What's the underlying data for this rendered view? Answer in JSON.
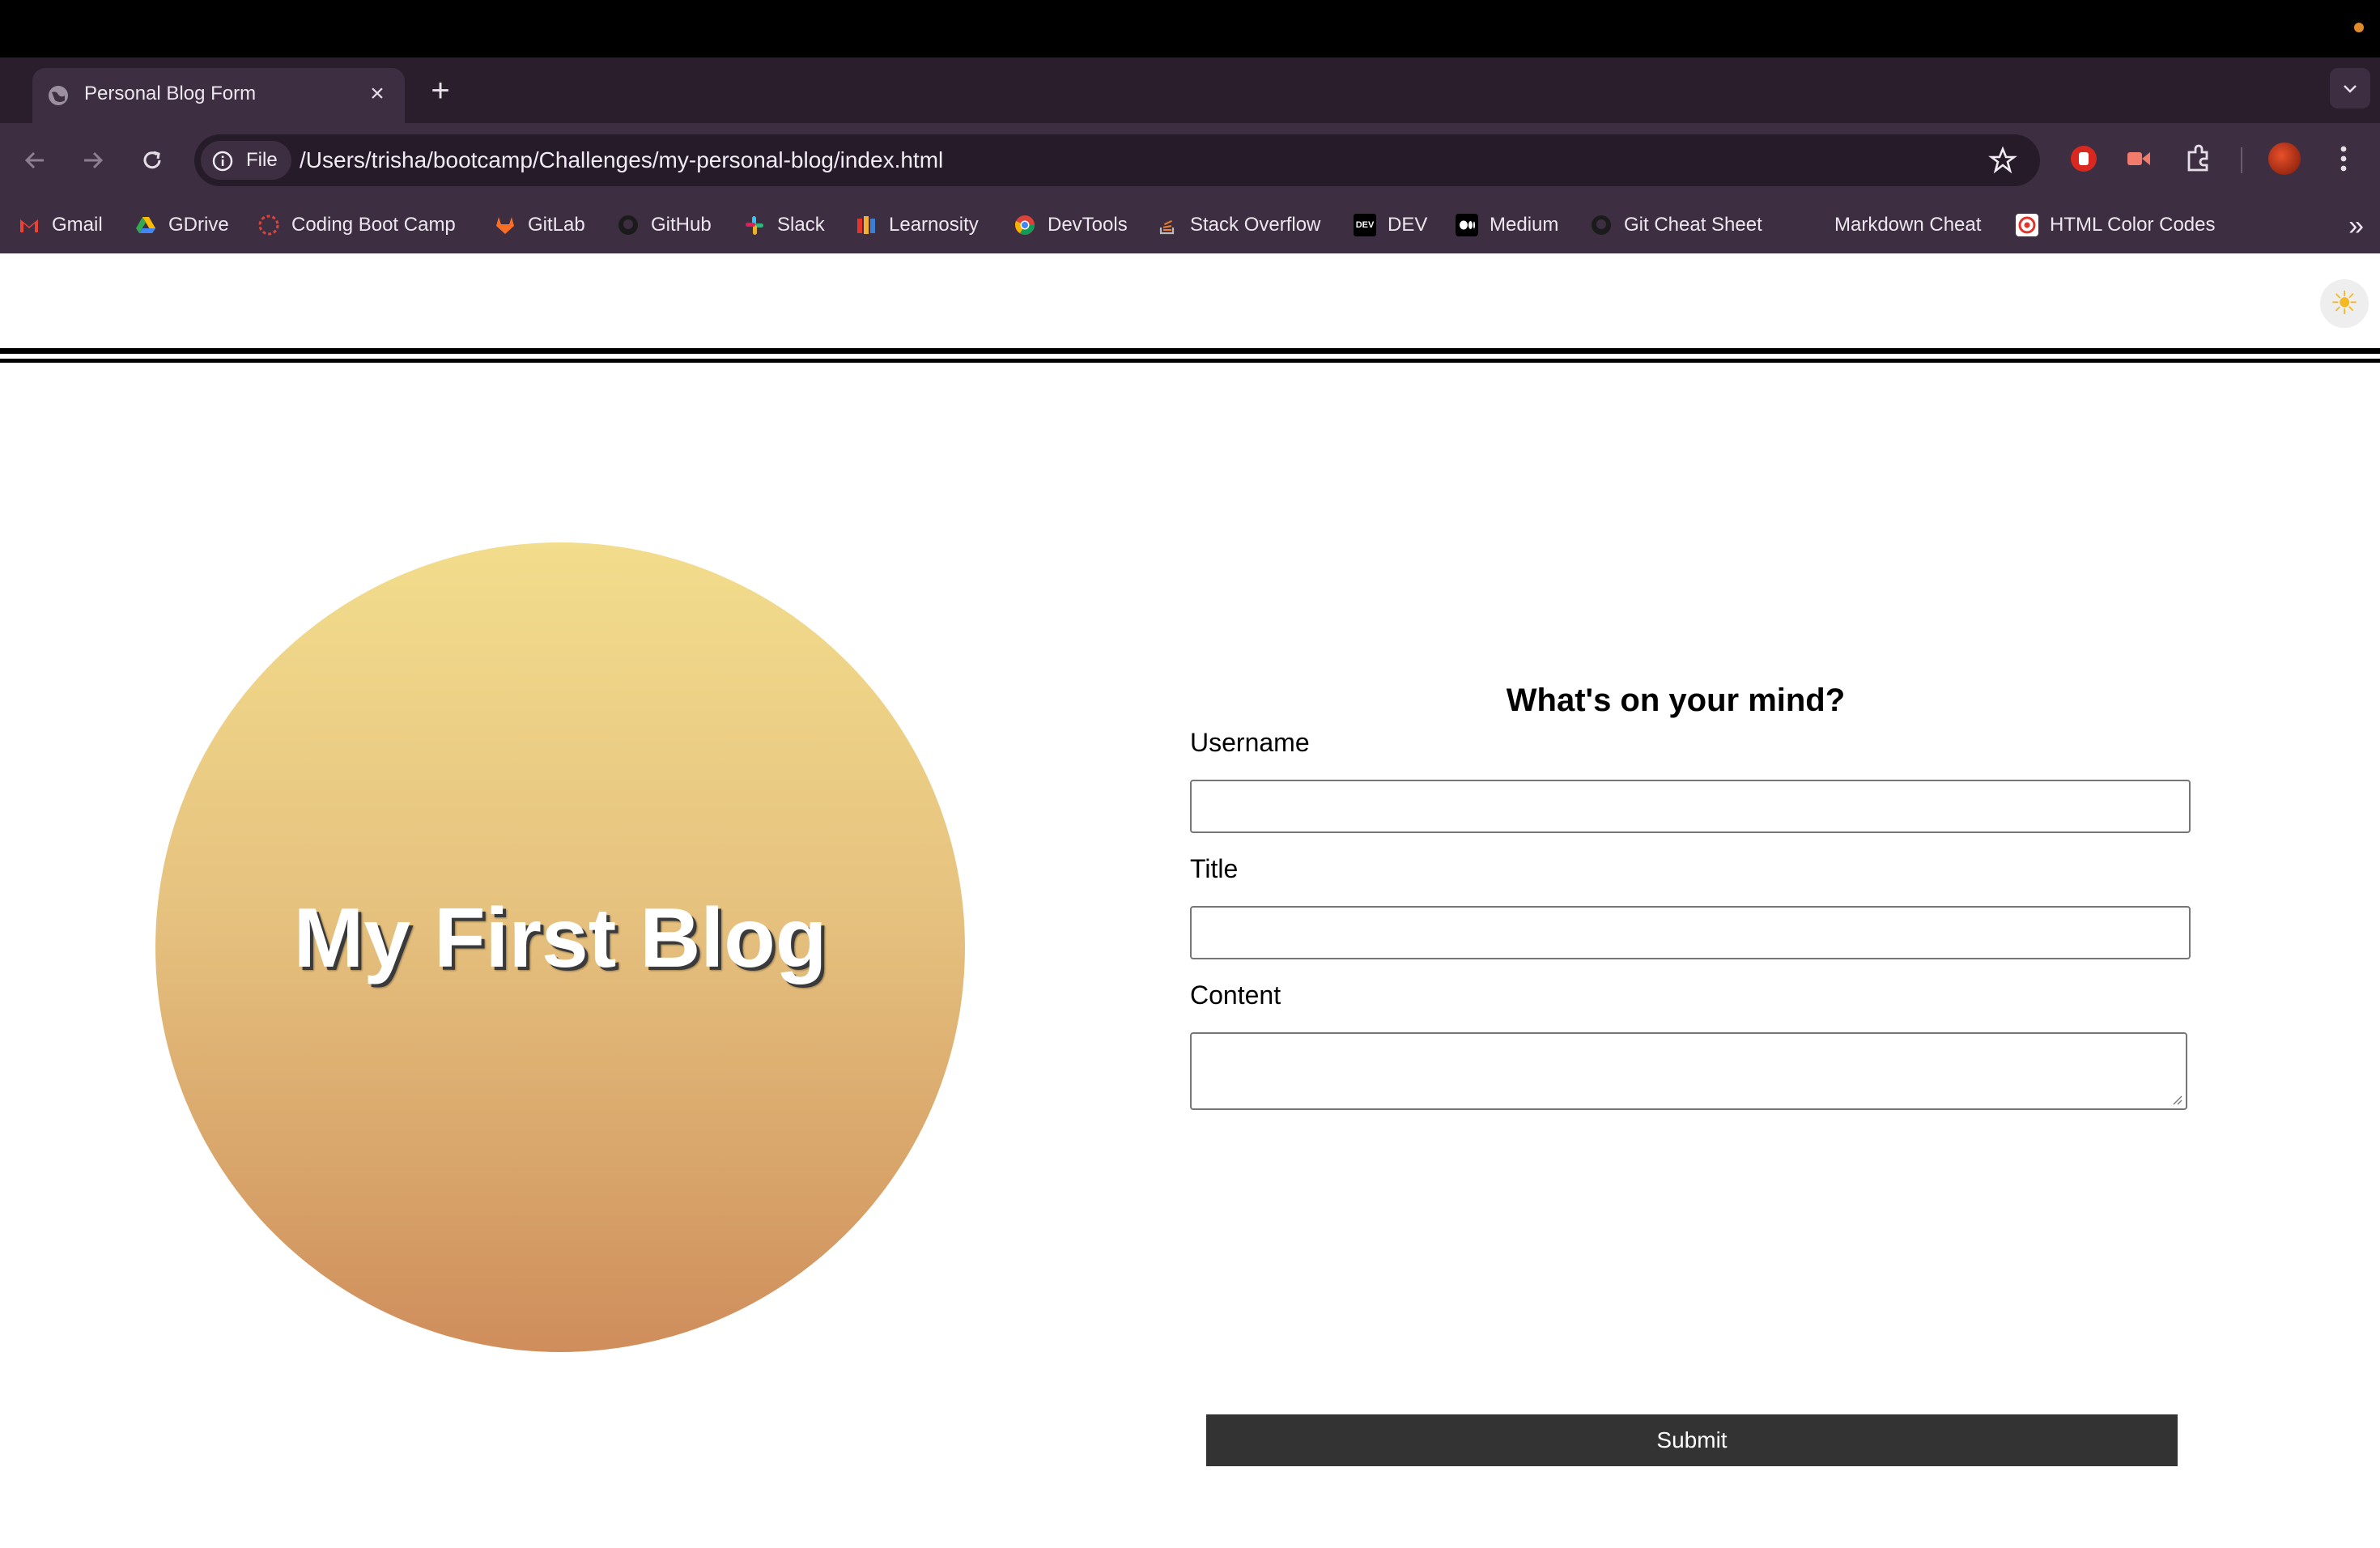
{
  "browser": {
    "tab": {
      "title": "Personal Blog Form"
    },
    "address": {
      "chip_label": "File",
      "url": "/Users/trisha/bootcamp/Challenges/my-personal-blog/index.html"
    },
    "bookmarks": [
      {
        "label": "Gmail",
        "icon": "gmail-icon",
        "color": "#ea4335"
      },
      {
        "label": "GDrive",
        "icon": "gdrive-icon",
        "color": "#34a853"
      },
      {
        "label": "Coding Boot Camp",
        "icon": "bootcamp-icon",
        "color": "#d9453a"
      },
      {
        "label": "GitLab",
        "icon": "gitlab-icon",
        "color": "#fc6d26"
      },
      {
        "label": "GitHub",
        "icon": "github-icon",
        "color": "#1b1b1b"
      },
      {
        "label": "Slack",
        "icon": "slack-icon",
        "color": "#36c5f0"
      },
      {
        "label": "Learnosity",
        "icon": "learnosity-icon",
        "color": "#f2b134"
      },
      {
        "label": "DevTools",
        "icon": "chrome-icon",
        "color": "#4285f4"
      },
      {
        "label": "Stack Overflow",
        "icon": "stackoverflow-icon",
        "color": "#f48024"
      },
      {
        "label": "DEV",
        "icon": "dev-icon",
        "color": "#000000"
      },
      {
        "label": "Medium",
        "icon": "medium-icon",
        "color": "#000000"
      },
      {
        "label": "Git Cheat Sheet",
        "icon": "github-icon",
        "color": "#1b1b1b"
      },
      {
        "label": "Markdown Cheat",
        "icon": "markdown-icon",
        "color": "#3d2f41"
      },
      {
        "label": "HTML Color Codes",
        "icon": "htmlcolor-icon",
        "color": "#e0352b"
      }
    ]
  },
  "page": {
    "hero_title": "My First Blog",
    "form": {
      "heading": "What's on your mind?",
      "username_label": "Username",
      "username_value": "",
      "title_label": "Title",
      "title_value": "",
      "content_label": "Content",
      "content_value": "",
      "submit_label": "Submit"
    },
    "theme_toggle_icon": "sun-icon"
  },
  "colors": {
    "chrome_dark": "#2a1e2d",
    "chrome_toolbar": "#3d2f41",
    "submit_bg": "#333333",
    "hero_top": "#f2dd8c",
    "hero_bottom": "#cf8d5c"
  }
}
